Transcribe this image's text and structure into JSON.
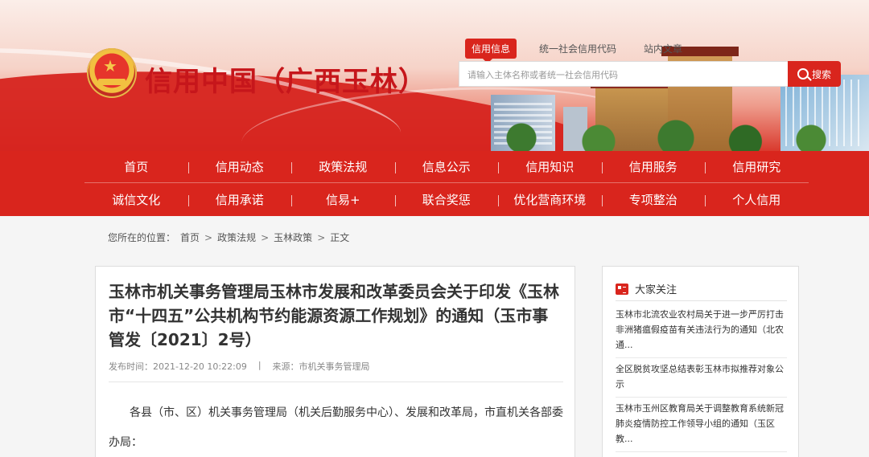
{
  "header": {
    "site_title": "信用中国（广西玉林）",
    "top_tabs": [
      "信用信息",
      "统一社会信用代码",
      "站内文章"
    ],
    "search": {
      "placeholder": "请输入主体名称或者统一社会信用代码",
      "button_label": "搜索"
    }
  },
  "nav": {
    "row1": [
      "首页",
      "信用动态",
      "政策法规",
      "信息公示",
      "信用知识",
      "信用服务",
      "信用研究"
    ],
    "row2": [
      "诚信文化",
      "信用承诺",
      "信易+",
      "联合奖惩",
      "优化营商环境",
      "专项整治",
      "个人信用"
    ]
  },
  "breadcrumb": {
    "label": "您所在的位置：",
    "items": [
      "首页",
      "政策法规",
      "玉林政策",
      "正文"
    ]
  },
  "article": {
    "title": "玉林市机关事务管理局玉林市发展和改革委员会关于印发《玉林市“十四五”公共机构节约能源资源工作规划》的通知（玉市事管发〔2021〕2号）",
    "publish_time": "发布时间：2021-12-20 10:22:09",
    "divider": "|",
    "source": "来源：市机关事务管理局",
    "body": "各县（市、区）机关事务管理局（机关后勤服务中心）、发展和改革局，市直机关各部委办局："
  },
  "sidebar": {
    "heading": "大家关注",
    "items": [
      "玉林市北流农业农村局关于进一步严厉打击非洲猪瘟假疫苗有关违法行为的通知（北农通...",
      "全区脱贫攻坚总结表彰玉林市拟推荐对象公示",
      "玉林市玉州区教育局关于调整教育系统新冠肺炎疫情防控工作领导小组的通知（玉区教..."
    ]
  }
}
